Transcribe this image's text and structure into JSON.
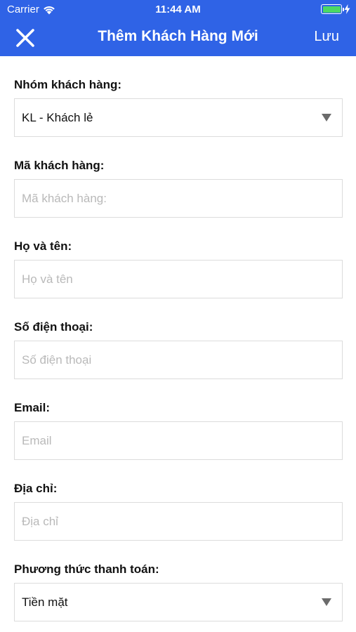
{
  "status_bar": {
    "carrier": "Carrier",
    "time": "11:44 AM",
    "battery_level": 1.0,
    "battery_color": "#4cd964"
  },
  "nav": {
    "close_icon": "close-icon",
    "title": "Thêm Khách Hàng Mới",
    "save_label": "Lưu",
    "background_color": "#2f63e6"
  },
  "form": {
    "group": {
      "label": "Nhóm khách hàng:",
      "value": "KL - Khách lẻ",
      "icon": "dropdown-caret-icon"
    },
    "code": {
      "label": "Mã khách hàng:",
      "placeholder": "Mã khách hàng:",
      "value": ""
    },
    "name": {
      "label": "Họ và tên:",
      "placeholder": "Họ và tên",
      "value": ""
    },
    "phone": {
      "label": "Số điện thoại:",
      "placeholder": "Số điện thoại",
      "value": ""
    },
    "email": {
      "label": "Email:",
      "placeholder": "Email",
      "value": ""
    },
    "address": {
      "label": "Địa chỉ:",
      "placeholder": "Địa chỉ",
      "value": ""
    },
    "payment": {
      "label": "Phương thức thanh toán:",
      "value": "Tiền mặt",
      "icon": "dropdown-caret-icon"
    }
  }
}
